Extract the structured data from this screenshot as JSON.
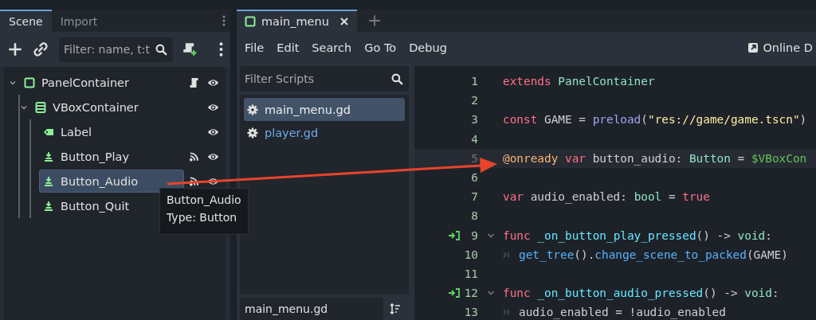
{
  "scene_dock": {
    "tabs": [
      {
        "label": "Scene",
        "selected": true
      },
      {
        "label": "Import",
        "selected": false
      }
    ],
    "filter": {
      "placeholder": "Filter: name, t:t"
    },
    "tree": [
      {
        "name": "PanelContainer",
        "kind": "panel",
        "expanded": true,
        "selected": false,
        "script": true,
        "children": [
          {
            "name": "VBoxContainer",
            "kind": "vbox",
            "expanded": true,
            "selected": false,
            "children": [
              {
                "name": "Label",
                "kind": "label",
                "selected": false
              },
              {
                "name": "Button_Play",
                "kind": "button",
                "selected": false,
                "signals": true
              },
              {
                "name": "Button_Audio",
                "kind": "button",
                "selected": true,
                "signals": true
              },
              {
                "name": "Button_Quit",
                "kind": "button",
                "selected": false
              }
            ]
          }
        ]
      }
    ],
    "tooltip": {
      "title": "Button_Audio",
      "type": "Type: Button"
    }
  },
  "editor": {
    "tabs": [
      {
        "label": "main_menu",
        "selected": true
      }
    ],
    "menu": [
      "File",
      "Edit",
      "Search",
      "Go To",
      "Debug"
    ],
    "online_docs": "Online D",
    "script_filter": {
      "placeholder": "Filter Scripts"
    },
    "scripts": [
      {
        "name": "main_menu.gd",
        "selected": true
      },
      {
        "name": "player.gd",
        "selected": false
      }
    ],
    "method_filter": {
      "value": "main_menu.gd"
    },
    "lines": [
      {
        "number": "1",
        "current": false,
        "tokens": [
          {
            "kind": "keyword",
            "text": "extends "
          },
          {
            "kind": "type",
            "text": "PanelContainer"
          }
        ]
      },
      {
        "number": "2",
        "current": false
      },
      {
        "number": "3",
        "current": false,
        "tokens": [
          {
            "kind": "keyword",
            "text": "const "
          },
          {
            "kind": "plain",
            "text": "GAME = "
          },
          {
            "kind": "function",
            "text": "preload"
          },
          {
            "kind": "plain",
            "text": "("
          },
          {
            "kind": "string",
            "text": "\"res://game/game.tscn\""
          },
          {
            "kind": "plain",
            "text": ")"
          }
        ]
      },
      {
        "number": "4",
        "current": false
      },
      {
        "number": "5",
        "current": true,
        "tokens": [
          {
            "kind": "annotation",
            "text": "@onready "
          },
          {
            "kind": "keyword",
            "text": "var "
          },
          {
            "kind": "plain",
            "text": "button_audio: "
          },
          {
            "kind": "type",
            "text": "Button"
          },
          {
            "kind": "plain",
            "text": " = "
          },
          {
            "kind": "nodepath",
            "text": "$VBoxCon"
          }
        ]
      },
      {
        "number": "6",
        "current": false
      },
      {
        "number": "7",
        "current": false,
        "tokens": [
          {
            "kind": "keyword",
            "text": "var "
          },
          {
            "kind": "plain",
            "text": "audio_enabled: "
          },
          {
            "kind": "type",
            "text": "bool"
          },
          {
            "kind": "plain",
            "text": " = "
          },
          {
            "kind": "keyword",
            "text": "true"
          }
        ]
      },
      {
        "number": "8",
        "current": false
      },
      {
        "number": "9",
        "current": false,
        "connected": true,
        "fold": true,
        "tokens": [
          {
            "kind": "keyword",
            "text": "func "
          },
          {
            "kind": "function",
            "text": "_on_button_play_pressed"
          },
          {
            "kind": "plain",
            "text": "() -> "
          },
          {
            "kind": "type",
            "text": "void"
          },
          {
            "kind": "plain",
            "text": ":"
          }
        ]
      },
      {
        "number": "10",
        "current": false,
        "indent": true,
        "tokens": [
          {
            "kind": "method",
            "text": "get_tree"
          },
          {
            "kind": "plain",
            "text": "()."
          },
          {
            "kind": "method",
            "text": "change_scene_to_packed"
          },
          {
            "kind": "plain",
            "text": "(GAME)"
          }
        ]
      },
      {
        "number": "11",
        "current": false
      },
      {
        "number": "12",
        "current": false,
        "connected": true,
        "fold": true,
        "tokens": [
          {
            "kind": "keyword",
            "text": "func "
          },
          {
            "kind": "function",
            "text": "_on_button_audio_pressed"
          },
          {
            "kind": "plain",
            "text": "() -> "
          },
          {
            "kind": "type",
            "text": "void"
          },
          {
            "kind": "plain",
            "text": ":"
          }
        ]
      },
      {
        "number": "13",
        "current": false,
        "indent": true,
        "tokens": [
          {
            "kind": "plain",
            "text": "audio_enabled = !audio_enabled"
          }
        ]
      }
    ]
  }
}
